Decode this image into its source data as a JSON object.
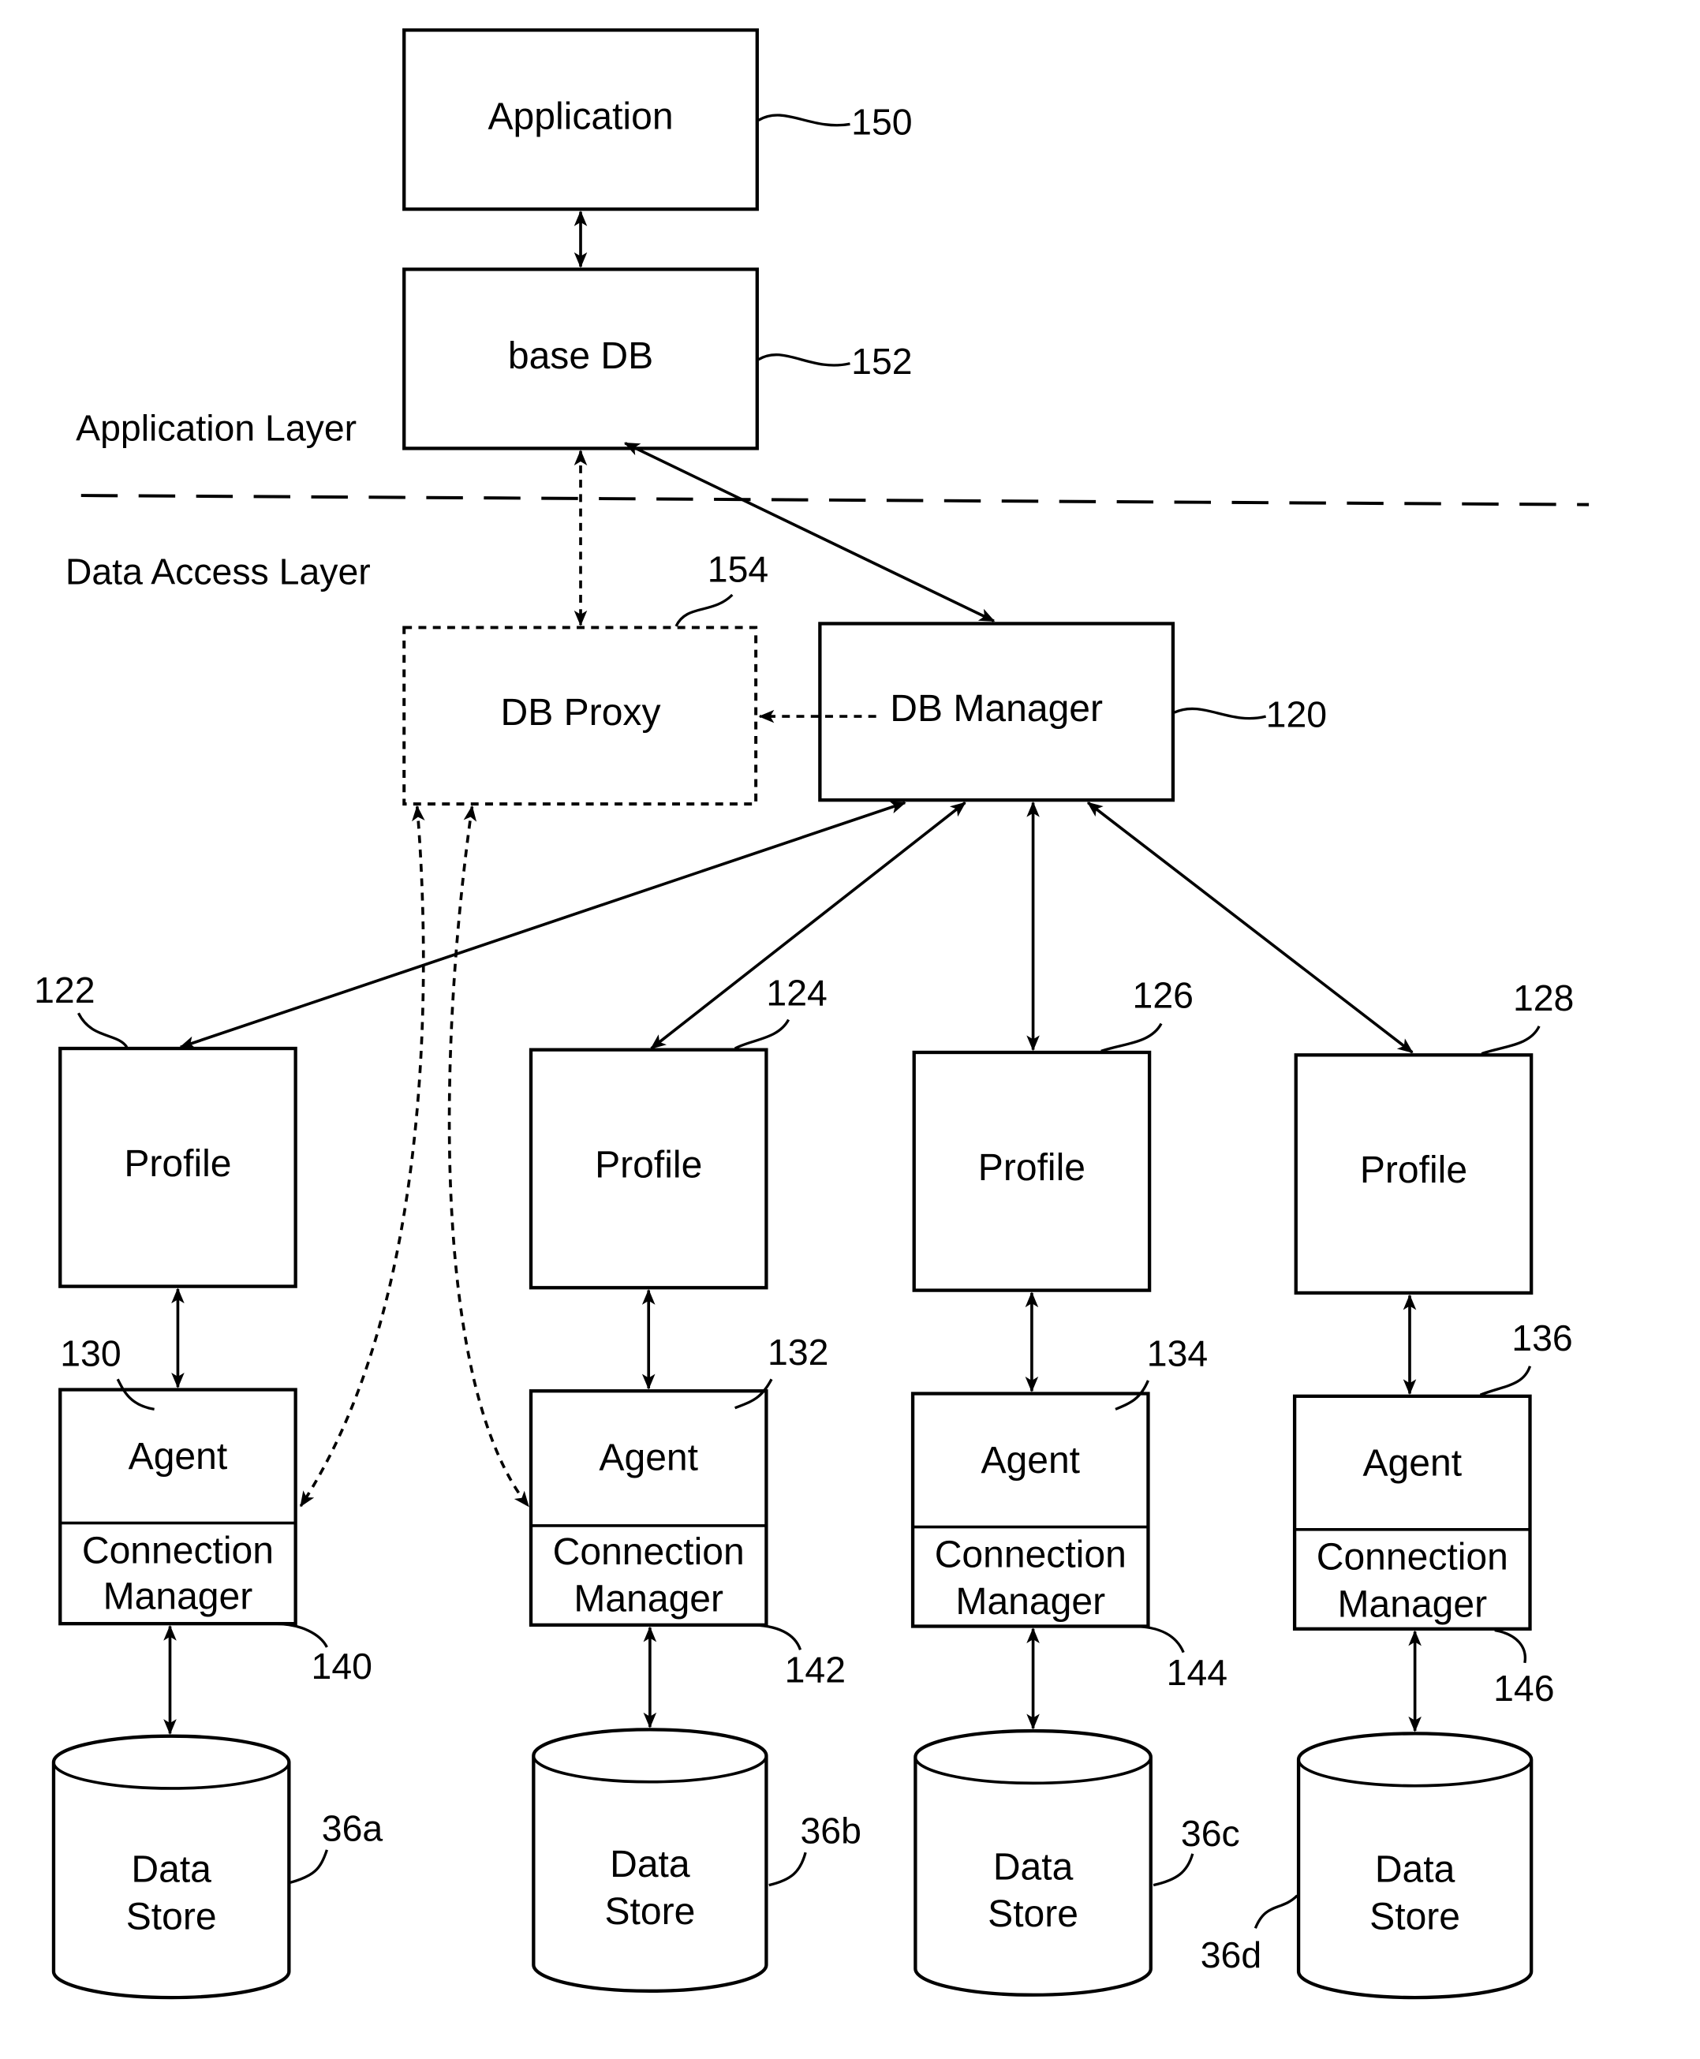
{
  "layers": {
    "application": "Application Layer",
    "data_access": "Data Access Layer"
  },
  "nodes": {
    "application": {
      "label": "Application",
      "ref": "150"
    },
    "base_db": {
      "label": "base DB",
      "ref": "152"
    },
    "db_proxy": {
      "label": "DB Proxy",
      "ref": "154"
    },
    "db_manager": {
      "label": "DB Manager",
      "ref": "120"
    }
  },
  "columns": [
    {
      "profile": {
        "label": "Profile",
        "ref": "122"
      },
      "agent": {
        "label": "Agent",
        "ref": "130"
      },
      "connection_manager": {
        "line1": "Connection",
        "line2": "Manager",
        "ref": "140"
      },
      "data_store": {
        "line1": "Data",
        "line2": "Store",
        "ref": "36a"
      }
    },
    {
      "profile": {
        "label": "Profile",
        "ref": "124"
      },
      "agent": {
        "label": "Agent",
        "ref": "132"
      },
      "connection_manager": {
        "line1": "Connection",
        "line2": "Manager",
        "ref": "142"
      },
      "data_store": {
        "line1": "Data",
        "line2": "Store",
        "ref": "36b"
      }
    },
    {
      "profile": {
        "label": "Profile",
        "ref": "126"
      },
      "agent": {
        "label": "Agent",
        "ref": "134"
      },
      "connection_manager": {
        "line1": "Connection",
        "line2": "Manager",
        "ref": "144"
      },
      "data_store": {
        "line1": "Data",
        "line2": "Store",
        "ref": "36c"
      }
    },
    {
      "profile": {
        "label": "Profile",
        "ref": "128"
      },
      "agent": {
        "label": "Agent",
        "ref": "136"
      },
      "connection_manager": {
        "line1": "Connection",
        "line2": "Manager",
        "ref": "146"
      },
      "data_store": {
        "line1": "Data",
        "line2": "Store",
        "ref": "36d"
      }
    }
  ]
}
